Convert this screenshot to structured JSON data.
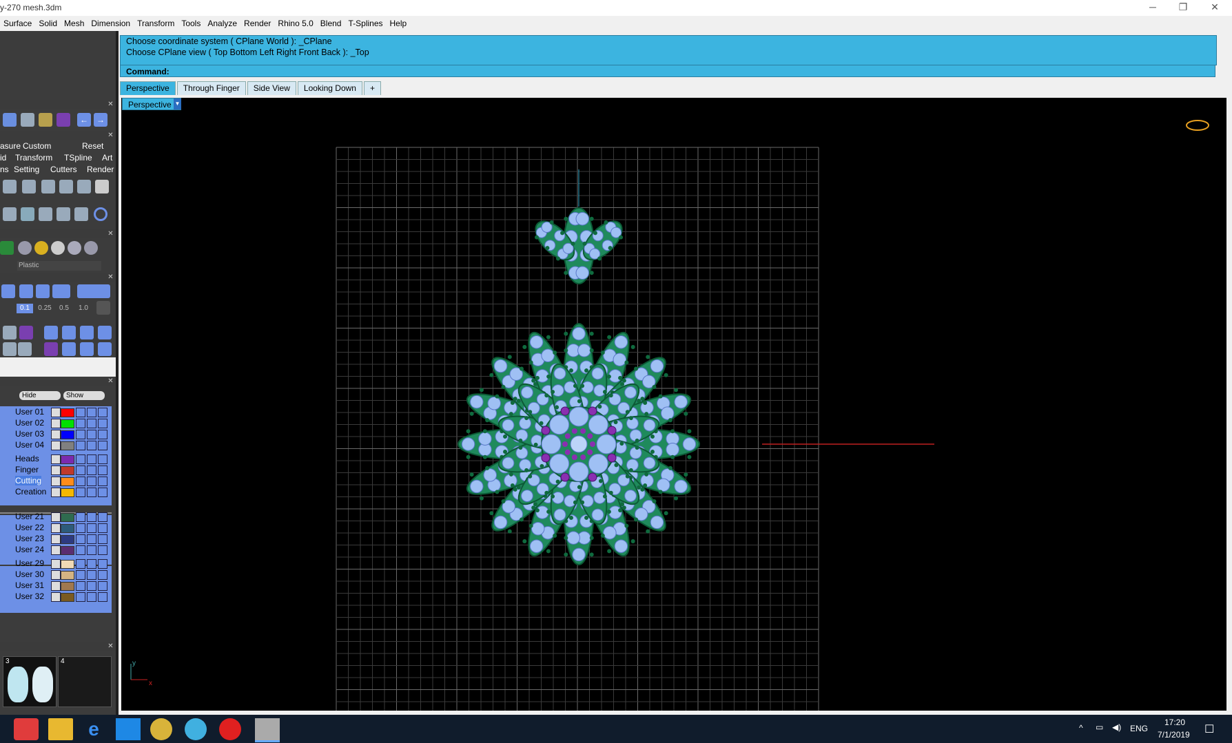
{
  "window": {
    "title": "y-270 mesh.3dm",
    "buttons": {
      "minimize": "─",
      "restore": "❐",
      "close": "✕"
    }
  },
  "menu": [
    "Surface",
    "Solid",
    "Mesh",
    "Dimension",
    "Transform",
    "Tools",
    "Analyze",
    "Render",
    "Rhino 5.0",
    "Blend",
    "T-Splines",
    "Help"
  ],
  "command": {
    "history": [
      "Choose coordinate system ( CPlane  World ): _CPlane",
      "Choose CPlane view ( Top  Bottom  Left  Right  Front  Back ): _Top"
    ],
    "prompt": "Command:"
  },
  "tabs": [
    "Perspective",
    "Through Finger",
    "Side View",
    "Looking Down"
  ],
  "tab_add": "+",
  "viewport": {
    "label": "Perspective",
    "axis_y": "y",
    "axis_x": "x"
  },
  "left_panel": {
    "tab_row1": [
      "asure",
      "Custom",
      "Reset"
    ],
    "tab_row2": [
      "id",
      "Transform",
      "TSpline",
      "Art"
    ],
    "tab_row3": [
      "ns",
      "Setting",
      "Cutters",
      "Render"
    ],
    "material": "Plastic",
    "snap_values": [
      "0.1",
      "0.25",
      "0.5",
      "1.0"
    ],
    "hide_label": "Hide",
    "show_label": "Show",
    "layers": [
      {
        "name": "User 01",
        "color": "#ff0000"
      },
      {
        "name": "User 02",
        "color": "#00e000"
      },
      {
        "name": "User 03",
        "color": "#0000ff"
      },
      {
        "name": "User 04",
        "color": "#808080"
      },
      {
        "name": "Heads",
        "color": "#7a2ab0"
      },
      {
        "name": "Finger",
        "color": "#c0392b"
      },
      {
        "name": "Cutting",
        "color": "#ff8c1a"
      },
      {
        "name": "Creation",
        "color": "#f5b800"
      },
      {
        "name": "User 21",
        "color": "#2f6b4f"
      },
      {
        "name": "User 22",
        "color": "#2d5b7a"
      },
      {
        "name": "User 23",
        "color": "#2d3a80"
      },
      {
        "name": "User 24",
        "color": "#5a2d70"
      },
      {
        "name": "User 29",
        "color": "#f0d9b5"
      },
      {
        "name": "User 30",
        "color": "#d4b483"
      },
      {
        "name": "User 31",
        "color": "#a07850"
      },
      {
        "name": "User 32",
        "color": "#7a5a20"
      }
    ],
    "thumb_labels": [
      "3",
      "4"
    ]
  },
  "taskbar": {
    "lang": "ENG",
    "time": "17:20",
    "date": "7/1/2019"
  }
}
